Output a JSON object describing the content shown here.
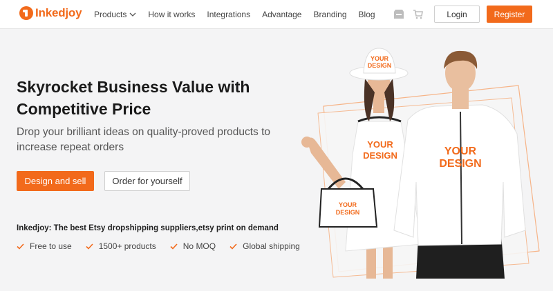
{
  "brand": {
    "name": "Inkedjoy",
    "color": "#f26a1b"
  },
  "nav": {
    "items": [
      {
        "label": "Products",
        "has_dropdown": true
      },
      {
        "label": "How it works"
      },
      {
        "label": "Integrations"
      },
      {
        "label": "Advantage"
      },
      {
        "label": "Branding"
      },
      {
        "label": "Blog"
      }
    ],
    "icons": [
      "store-icon",
      "cart-icon"
    ],
    "login_label": "Login",
    "register_label": "Register"
  },
  "hero": {
    "title": "Skyrocket Business Value with Competitive Price",
    "subtitle": "Drop your brilliant ideas on quality-proved products to increase repeat orders",
    "primary_button": "Design and sell",
    "secondary_button": "Order for yourself",
    "tagline": "Inkedjoy: The best Etsy dropshipping suppliers,etsy print on demand",
    "features": [
      "Free to use",
      "1500+ products",
      "No MOQ",
      "Global shipping"
    ]
  },
  "illustration": {
    "hat_text": [
      "YOUR",
      "DESIGN"
    ],
    "dress_text": [
      "YOUR",
      "DESIGN"
    ],
    "bag_text": [
      "YOUR",
      "DESIGN"
    ],
    "hoodie_text": [
      "YOUR",
      "DESIGN"
    ]
  }
}
